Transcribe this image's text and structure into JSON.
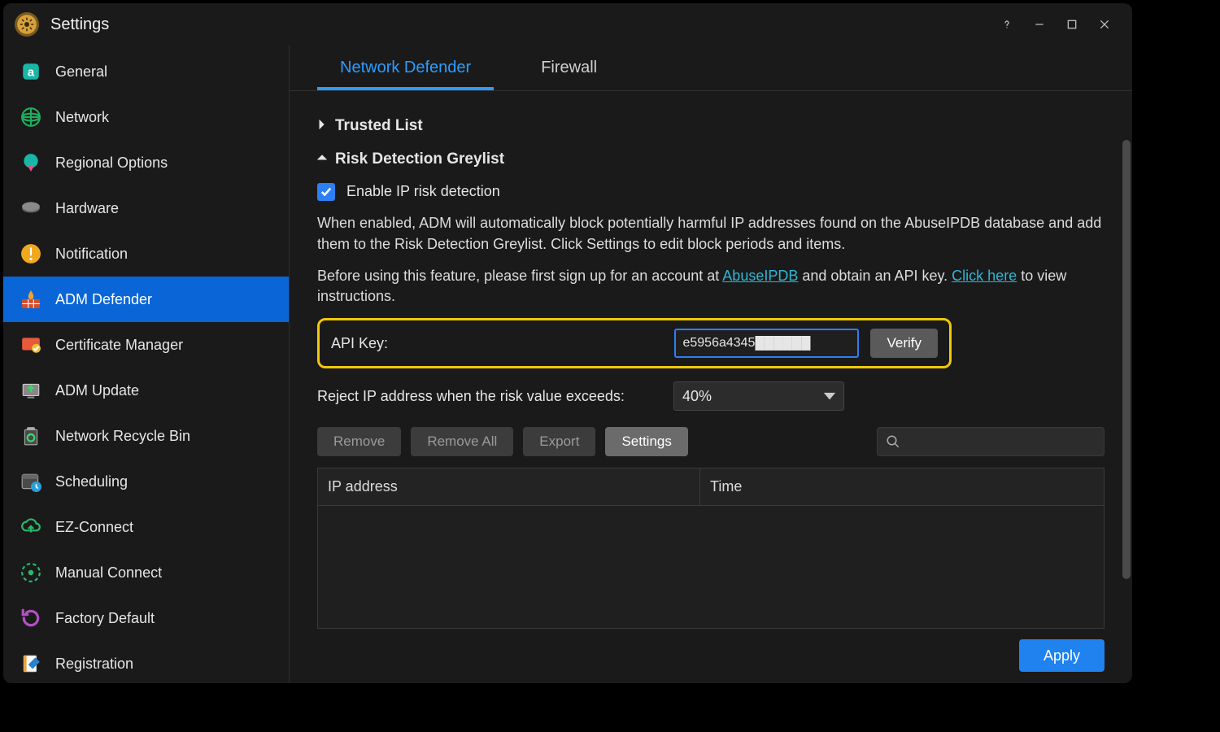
{
  "window": {
    "title": "Settings"
  },
  "sidebar": {
    "items": [
      {
        "label": "General"
      },
      {
        "label": "Network"
      },
      {
        "label": "Regional Options"
      },
      {
        "label": "Hardware"
      },
      {
        "label": "Notification"
      },
      {
        "label": "ADM Defender"
      },
      {
        "label": "Certificate Manager"
      },
      {
        "label": "ADM Update"
      },
      {
        "label": "Network Recycle Bin"
      },
      {
        "label": "Scheduling"
      },
      {
        "label": "EZ-Connect"
      },
      {
        "label": "Manual Connect"
      },
      {
        "label": "Factory Default"
      },
      {
        "label": "Registration"
      }
    ],
    "active_index": 5
  },
  "tabs": {
    "items": [
      {
        "label": "Network Defender"
      },
      {
        "label": "Firewall"
      }
    ],
    "active_index": 0
  },
  "sections": {
    "trusted": {
      "title": "Trusted List",
      "expanded": false
    },
    "greylist": {
      "title": "Risk Detection Greylist",
      "expanded": true
    }
  },
  "greylist": {
    "enable_label": "Enable IP risk detection",
    "enable_checked": true,
    "desc1": "When enabled, ADM will automatically block potentially harmful IP addresses found on the AbuseIPDB database and add them to the Risk Detection Greylist. Click Settings to edit block periods and items.",
    "desc2_prefix": "Before using this feature, please first sign up for an account at ",
    "desc2_link1": "AbuseIPDB",
    "desc2_mid": " and obtain an API key. ",
    "desc2_link2": "Click here",
    "desc2_suffix": " to view instructions.",
    "api_key_label": "API Key:",
    "api_key_value": "e5956a4345██████",
    "verify_label": "Verify",
    "reject_label": "Reject IP address when the risk value exceeds:",
    "reject_value": "40%",
    "buttons": {
      "remove": "Remove",
      "remove_all": "Remove All",
      "export": "Export",
      "settings": "Settings"
    },
    "search_placeholder": "",
    "columns": {
      "ip": "IP address",
      "time": "Time"
    }
  },
  "footer": {
    "apply": "Apply"
  }
}
